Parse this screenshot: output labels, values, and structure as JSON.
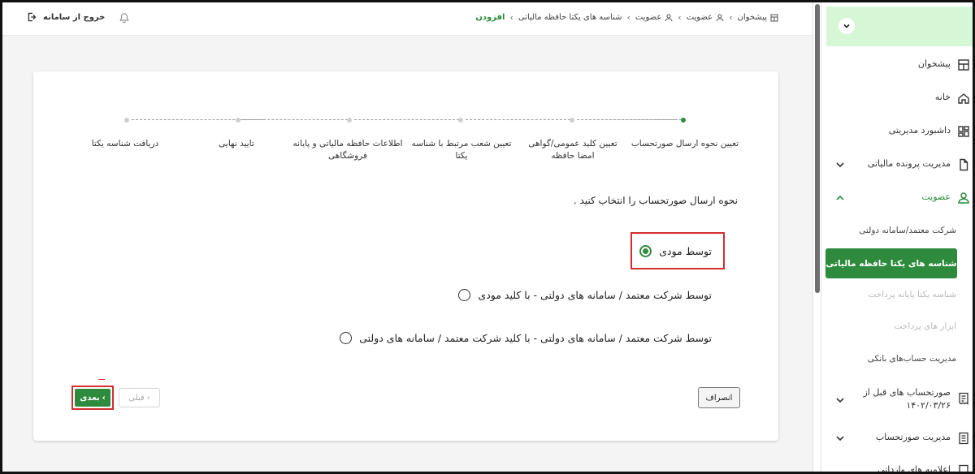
{
  "topbar": {
    "logout_label": "خروج از سامانه",
    "breadcrumb": [
      {
        "label": "پیشخوان",
        "icon": "dashboard-icon"
      },
      {
        "label": "عضویت",
        "icon": "user-icon"
      },
      {
        "label": "عضویت",
        "icon": "user-icon"
      },
      {
        "label": "شناسه های یکتا حافظه مالیاتی",
        "icon": ""
      },
      {
        "label": "افزودن",
        "icon": ""
      }
    ]
  },
  "stepper": {
    "steps": [
      {
        "label": "تعیین نحوه ارسال صورتحساب",
        "state": "active"
      },
      {
        "label": "تعیین کلید عمومی/گواهی امضا حافظه",
        "state": "pending"
      },
      {
        "label": "تعیین شعب مرتبط با شناسه یکتا",
        "state": "pending"
      },
      {
        "label": "اطلاعات حافظه مالیاتی و پایانه فروشگاهی",
        "state": "pending"
      },
      {
        "label": "تایید نهایی",
        "state": "pending"
      },
      {
        "label": "دریافت شناسه یکتا",
        "state": "pending"
      }
    ]
  },
  "form": {
    "question": "نحوه ارسال صورتحساب را انتخاب کنید .",
    "options": [
      {
        "label": "توسط مودی",
        "selected": true
      },
      {
        "label": "توسط شرکت معتمد / سامانه های دولتی - با کلید مودی",
        "selected": false
      },
      {
        "label": "توسط شرکت معتمد / سامانه های دولتی - با کلید شرکت معتمد / سامانه های دولتی",
        "selected": false
      }
    ],
    "cancel_label": "انصراف",
    "prev_label": "قبلی",
    "next_label": "بعدی"
  },
  "sidebar": {
    "items": [
      {
        "label": "پیشخوان",
        "icon": "dashboard-icon"
      },
      {
        "label": "خانه",
        "icon": "home-icon"
      },
      {
        "label": "داشبورد مدیریتی",
        "icon": "grid-icon"
      },
      {
        "label": "مدیریت پرونده مالیاتی",
        "icon": "file-icon"
      },
      {
        "label": "عضویت",
        "icon": "user-icon"
      }
    ],
    "subitems": [
      {
        "label": "شرکت معتمد/سامانه دولتی",
        "state": "normal"
      },
      {
        "label": "شناسه های یکتا حافظه مالیاتی",
        "state": "active"
      },
      {
        "label": "شناسه یکتا پایانه پرداخت",
        "state": "disabled"
      },
      {
        "label": "ابزار های پرداخت",
        "state": "disabled"
      },
      {
        "label": "مدیریت حساب‌های بانکی",
        "state": "normal"
      }
    ],
    "bottom_items": [
      {
        "label": "صورتحساب های قبل از",
        "label2": "۱۴۰۲/۰۳/۲۶",
        "icon": "receipt-icon"
      },
      {
        "label": "مدیریت صورتحساب",
        "icon": "invoice-icon"
      },
      {
        "label": "اعلامیه های وارداتی",
        "icon": "import-icon"
      }
    ]
  },
  "colors": {
    "accent": "#2e8b3e",
    "highlight": "#d32f2f",
    "sidebar_header": "#d6f7d6"
  }
}
